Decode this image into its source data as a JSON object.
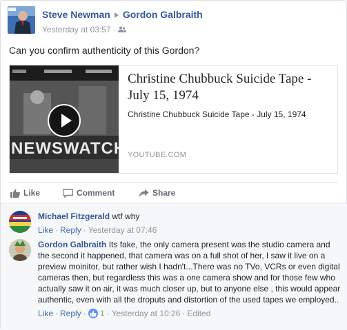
{
  "post": {
    "author": "Steve Newman",
    "target": "Gordon Galbraith",
    "timestamp": "Yesterday at 03:57",
    "audience_icon": "friends-icon",
    "text": "Can you confirm authenticity of this Gordon?"
  },
  "link": {
    "title": "Christine Chubbuck Suicide Tape - July 15, 1974",
    "description": "Christine Chubbuck Suicide Tape - July 15, 1974",
    "domain": "YOUTUBE.COM",
    "thumbnail_caption": "NEWSWATCH"
  },
  "actions": {
    "like": "Like",
    "comment": "Comment",
    "share": "Share"
  },
  "comments": [
    {
      "author": "Michael Fitzgerald",
      "text": "wtf why",
      "like": "Like",
      "reply": "Reply",
      "timestamp": "Yesterday at 07:46"
    },
    {
      "author": "Gordon Galbraith",
      "text": "Its fake, the only camera present was the studio camera and the second it happened, that camera was on a full shot of her, I saw it live on a preview moinitor, but rather wish I hadn't...There was no TVo, VCRs or even digital cameras then, but regardless this was a one camera show and for those few who actually saw it on air, it was much closer up, but to anyone else , this would appear authentic, even with all the droputs and distortion of the used tapes we employed..",
      "like": "Like",
      "reply": "Reply",
      "reaction_count": "1",
      "timestamp": "Yesterday at 10:26",
      "edited": "Edited"
    }
  ],
  "colors": {
    "link_blue": "#365899",
    "action_blue": "#4267b2",
    "meta_gray": "#90949c",
    "comment_bg": "#f6f7f9"
  }
}
